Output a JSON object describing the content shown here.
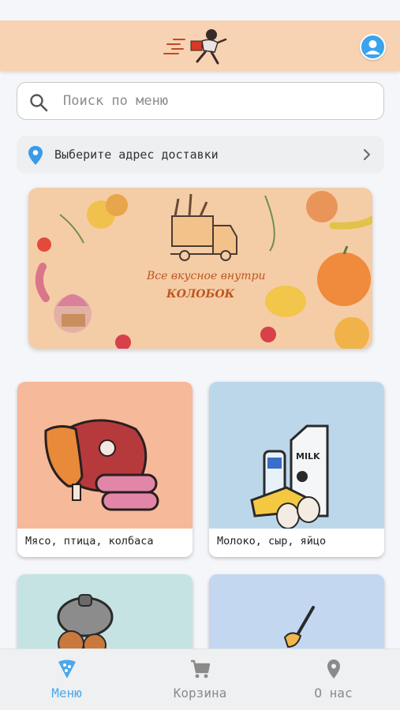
{
  "header": {
    "logo": "running-courier-logo",
    "profile_icon": "profile-icon"
  },
  "search": {
    "placeholder": "Поиск по меню",
    "icon": "search-icon"
  },
  "address": {
    "label": "Выберите адрес доставки",
    "icon": "location-pin-icon",
    "chevron": "chevron-right-icon"
  },
  "banner": {
    "slogan": "Все вкусное внутри",
    "brand": "КОЛОБОК"
  },
  "categories": [
    {
      "label": "Мясо, птица, колбаса",
      "color": "#f6b99a"
    },
    {
      "label": "Молоко, сыр, яйцо",
      "color": "#bdd7ea"
    },
    {
      "label": "",
      "color": "#c5e3e2"
    },
    {
      "label": "",
      "color": "#c3d8f0"
    }
  ],
  "tabs": [
    {
      "label": "Меню",
      "icon": "menu-pizza-icon",
      "active": true
    },
    {
      "label": "Корзина",
      "icon": "cart-icon",
      "active": false
    },
    {
      "label": "О нас",
      "icon": "location-pin-icon",
      "active": false
    }
  ],
  "colors": {
    "header": "#f7d3b3",
    "accent": "#4aa8ec",
    "banner": "#f4cda6"
  }
}
